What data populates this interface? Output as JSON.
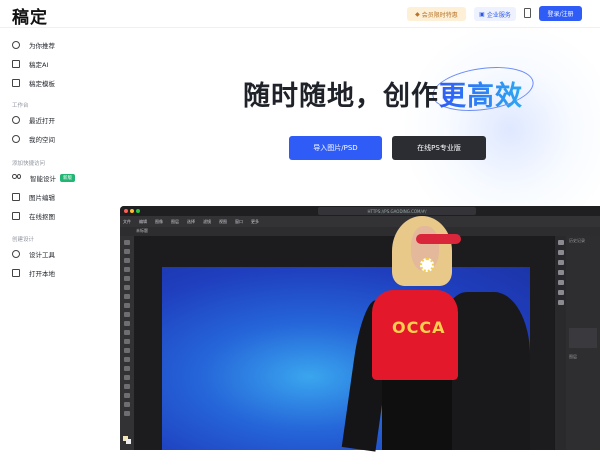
{
  "header": {
    "logo": "稿定",
    "vip_label": "会员限时特惠",
    "enterprise_label": "企业服务",
    "login_label": "登录/注册"
  },
  "sidebar": {
    "items_top": [
      {
        "label": "为你推荐",
        "icon": "compass-icon"
      },
      {
        "label": "稿定AI",
        "icon": "ai-scan-icon"
      },
      {
        "label": "稿定模板",
        "icon": "template-icon"
      }
    ],
    "workspace_title": "工作台",
    "items_workspace": [
      {
        "label": "最近打开",
        "icon": "clock-icon"
      },
      {
        "label": "我的空间",
        "icon": "user-space-icon"
      }
    ],
    "quick_title": "添加快捷访问",
    "items_quick": [
      {
        "label": "智能设计",
        "icon": "infinity-icon",
        "badge": "新版"
      },
      {
        "label": "图片编辑",
        "icon": "image-edit-icon"
      },
      {
        "label": "在线抠图",
        "icon": "cutout-icon"
      }
    ],
    "create_title": "创建设计",
    "items_create": [
      {
        "label": "设计工具",
        "icon": "design-tool-icon"
      },
      {
        "label": "打开本地",
        "icon": "folder-icon"
      }
    ]
  },
  "hero": {
    "title_plain": "随时随地，创作",
    "title_highlight": "更高效",
    "import_label": "导入图片/PSD",
    "ps_label": "在线PS专业版"
  },
  "editor": {
    "url": "HTTPS://PS.GAODING.COM/#/",
    "menus": [
      "文件",
      "编辑",
      "图像",
      "图层",
      "选择",
      "滤镜",
      "视图",
      "窗口",
      "更多"
    ],
    "tab": "未标题",
    "shirt_text": "OCCA",
    "panel_head": "历史记录",
    "panel_bottom": "图层"
  },
  "colors": {
    "primary": "#2f5cf6",
    "dark_button": "#2b2d33",
    "badge_green": "#22b573"
  }
}
